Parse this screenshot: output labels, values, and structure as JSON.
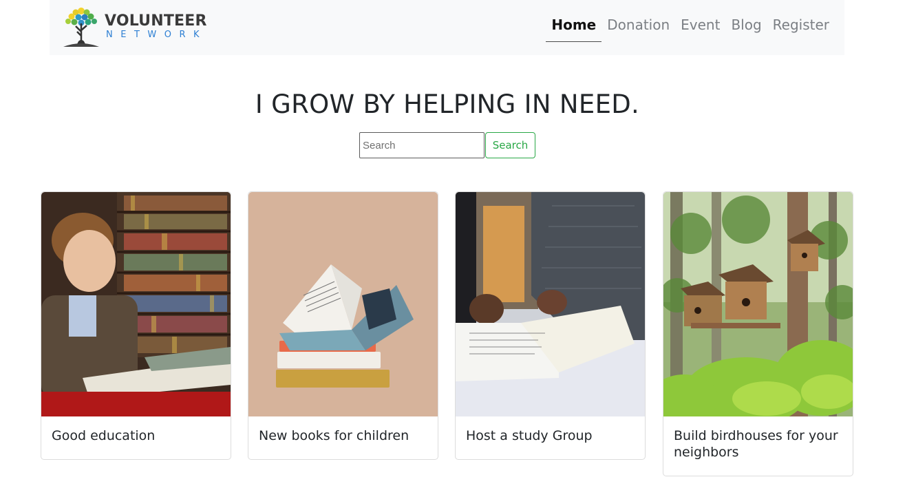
{
  "brand": {
    "name": "VOLUNTEER",
    "tagline": "NETWORK"
  },
  "nav": {
    "items": [
      {
        "label": "Home",
        "active": true
      },
      {
        "label": "Donation",
        "active": false
      },
      {
        "label": "Event",
        "active": false
      },
      {
        "label": "Blog",
        "active": false
      },
      {
        "label": "Register",
        "active": false
      }
    ]
  },
  "hero": {
    "title": "I GROW BY HELPING IN NEED."
  },
  "search": {
    "placeholder": "Search",
    "value": "",
    "button_label": "Search"
  },
  "cards": [
    {
      "title": "Good education",
      "image": "boy-reading-in-library"
    },
    {
      "title": "New books for children",
      "image": "stack-of-open-books"
    },
    {
      "title": "Host a study Group",
      "image": "people-reading-papers"
    },
    {
      "title": "Build birdhouses for your neighbors",
      "image": "birdhouses-in-forest"
    }
  ],
  "colors": {
    "navbar_bg": "#f8f9fa",
    "accent_green": "#28a745",
    "logo_blue": "#2d7fd3"
  }
}
